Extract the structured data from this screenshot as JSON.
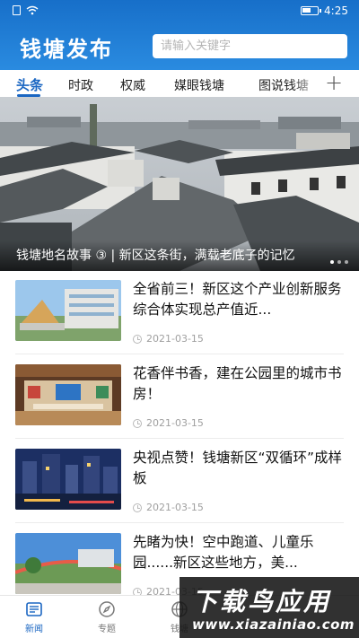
{
  "status_bar": {
    "time": "4:25"
  },
  "header": {
    "app_title": "钱塘发布",
    "search_placeholder": "请输入关键字"
  },
  "tabs": [
    {
      "label": "头条",
      "active": true
    },
    {
      "label": "时政"
    },
    {
      "label": "权威"
    },
    {
      "label": "媒眼钱塘"
    },
    {
      "label": "图说钱塘"
    }
  ],
  "hero": {
    "caption": "钱塘地名故事 ③ | 新区这条街，满载老底子的记忆"
  },
  "news": [
    {
      "title": "全省前三！新区这个产业创新服务综合体实现总产值近...",
      "date": "2021-03-15"
    },
    {
      "title": "花香伴书香，建在公园里的城市书房！",
      "date": "2021-03-15"
    },
    {
      "title": "央视点赞！钱塘新区“双循环”成样板",
      "date": "2021-03-15"
    },
    {
      "title": "先睹为快！空中跑道、儿童乐园......新区这些地方，美...",
      "date": "2021-03-15"
    }
  ],
  "bottom_nav": [
    {
      "label": "新闻",
      "active": true
    },
    {
      "label": "专题"
    },
    {
      "label": "钱塘"
    }
  ],
  "watermark": {
    "text": "下载鸟应用",
    "url": "www.xiazainiao.com"
  },
  "colors": {
    "primary": "#1a66c2",
    "header_top": "#176fc9",
    "header_bottom": "#2a8be0"
  }
}
